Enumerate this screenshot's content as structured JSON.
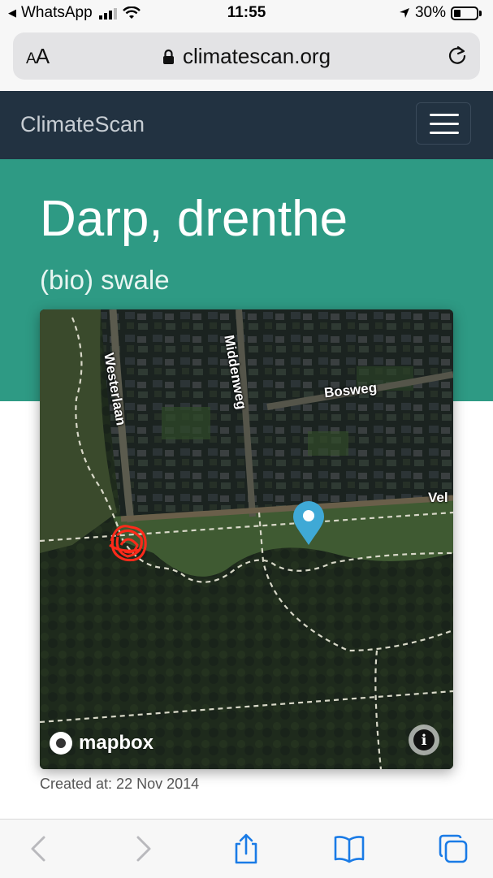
{
  "status_bar": {
    "back_app": "WhatsApp",
    "time": "11:55",
    "battery_percent": "30%",
    "battery_level": 0.3
  },
  "browser": {
    "text_size_label_small": "A",
    "text_size_label_large": "A",
    "url": "climatescan.org"
  },
  "navbar": {
    "brand": "ClimateScan"
  },
  "hero": {
    "title": "Darp, drenthe",
    "subtitle": "(bio) swale"
  },
  "map": {
    "street_labels": {
      "westerlaan": "Westerlaan",
      "middenweg": "Middenweg",
      "bosweg": "Bosweg",
      "vel": "Vel"
    },
    "attribution": "mapbox",
    "info_icon": "info-icon",
    "marker_icon": "map-pin-icon"
  },
  "meta": {
    "created_at": "Created at: 22 Nov 2014"
  },
  "colors": {
    "navbar": "#223241",
    "hero": "#2e9a84",
    "marker": "#3fa9d6",
    "toolbar_icon": "#1a7be6"
  }
}
